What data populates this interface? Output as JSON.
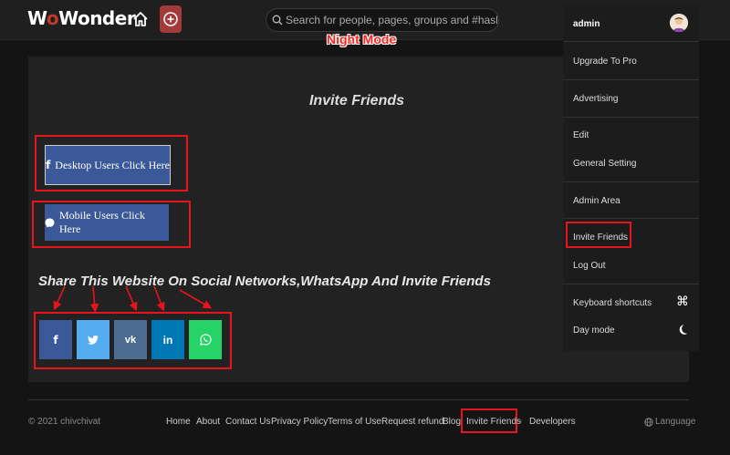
{
  "header": {
    "logo": {
      "part1": "W",
      "part2": "o",
      "part3": "Wonder"
    },
    "search_placeholder": "Search for people, pages, groups and #hashtags",
    "annotation": "Night Mode"
  },
  "main": {
    "title": "Invite Friends",
    "desktop_button": "Desktop Users Click Here",
    "mobile_button": "Mobile Users Click Here",
    "share_title": "Share This Website On Social Networks,WhatsApp And Invite Friends",
    "social": [
      {
        "name": "facebook",
        "glyph": "f",
        "color": "#3b5998"
      },
      {
        "name": "twitter",
        "glyph": "t",
        "color": "#55acee"
      },
      {
        "name": "vk",
        "glyph": "vk",
        "color": "#4c6c91"
      },
      {
        "name": "linkedin",
        "glyph": "in",
        "color": "#0077b5"
      },
      {
        "name": "whatsapp",
        "glyph": "w",
        "color": "#25d366"
      }
    ]
  },
  "dropdown": {
    "username": "admin",
    "items": {
      "upgrade": "Upgrade To Pro",
      "advertising": "Advertising",
      "edit": "Edit",
      "general": "General Setting",
      "admin_area": "Admin Area",
      "invite": "Invite Friends",
      "logout": "Log Out",
      "shortcuts": "Keyboard shortcuts",
      "day_mode": "Day mode"
    }
  },
  "footer": {
    "copyright": "© 2021 chivchivat",
    "links": {
      "home": "Home",
      "about": "About",
      "contact": "Contact Us",
      "privacy": "Privacy Policy",
      "terms": "Terms of Use",
      "refund": "Request refund",
      "blog": "Blog",
      "invite": "Invite Friends",
      "developers": "Developers"
    },
    "separator": "-",
    "language": "Language"
  },
  "colors": {
    "accent_red": "#e8131b",
    "facebook": "#3b5998",
    "background": "#141414"
  }
}
